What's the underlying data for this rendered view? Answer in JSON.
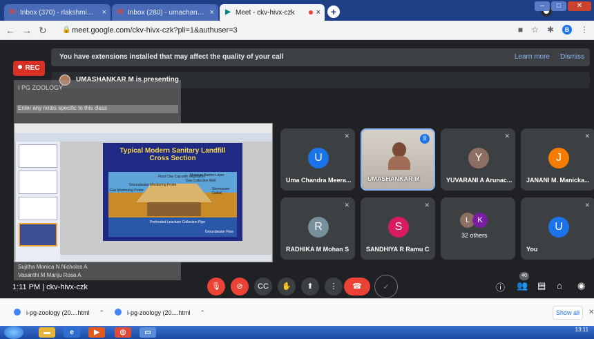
{
  "browser": {
    "tabs": [
      {
        "title": "Inbox (370) - rlakshmi@euxilium...",
        "icon": "gmail-icon",
        "fav": "M",
        "active": false
      },
      {
        "title": "Inbox (280) - umachandran@au...",
        "icon": "gmail-icon",
        "fav": "M",
        "active": false
      },
      {
        "title": "Meet - ckv-hivx-czk",
        "icon": "meet-icon",
        "fav": "▶",
        "active": true
      }
    ],
    "new_tab": "+",
    "url": "meet.google.com/ckv-hivx-czk?pli=1&authuser=3"
  },
  "meet": {
    "extension_banner": "You have extensions installed that may affect the quality of your call",
    "learn_more": "Learn more",
    "dismiss": "Dismiss",
    "rec_label": "REC",
    "presenting": "UMASHANKAR M is presenting",
    "ghost_title": "I PG ZOOLOGY",
    "ghost_note": "Enter any notes specific to this class",
    "ghost_rows": [
      "Sujitha Monica N Nicholas A",
      "Vasanthi M Manju Rosa A"
    ],
    "slide_title_line1": "Typical Modern Sanitary Landfill",
    "slide_title_line2": "Cross Section",
    "slide_labels": {
      "gas_monitoring": "Gas Monitoring Probe",
      "groundwater": "Groundwater Monitoring Probe",
      "final_cap": "Final Clay Cap with Vegetation",
      "moisture": "Moisture Barrier Layer",
      "landfill_gas": "Landfill Gas to Fuel Source or Energy Utilization Plant",
      "gas_well": "Gas Collection Well",
      "stormwater": "Stormwater Outfall",
      "perforated": "Perforated Leachate Collection Pipe",
      "groundwater_flow": "Groundwater Flow"
    },
    "participants": [
      {
        "name": "Uma Chandra Meera...",
        "initial": "U",
        "color": "#1a73e8",
        "muted": true
      },
      {
        "name": "UMASHANKAR M",
        "initial": "",
        "color": "",
        "muted": false,
        "speaking": true
      },
      {
        "name": "YUVARANI A Arunac...",
        "initial": "Y",
        "color": "#8d6e63",
        "muted": true
      },
      {
        "name": "JANANI M. Manicka...",
        "initial": "J",
        "color": "#f57c00",
        "muted": true
      },
      {
        "name": "RADHIKA M Mohan S",
        "initial": "R",
        "color": "#78909c",
        "muted": true
      },
      {
        "name": "SANDHIYA R Ramu C",
        "initial": "S",
        "color": "#d81b60",
        "muted": true
      },
      {
        "name": "32 others",
        "initial": "",
        "color": "",
        "muted": false
      },
      {
        "name": "You",
        "initial": "U",
        "color": "#1a73e8",
        "muted": true
      }
    ],
    "others_initials": [
      "L",
      "K"
    ],
    "meeting_time": "1:11 PM",
    "meeting_code": "ckv-hivx-czk",
    "participant_count": "40"
  },
  "downloads": {
    "items": [
      "i-pg-zoology (20....html",
      "i-pg-zoology (20....html"
    ],
    "show_all": "Show all"
  },
  "taskbar": {
    "time": "13:11"
  },
  "colors": {
    "meet_bg": "#202124",
    "tile_bg": "#3c4043",
    "hang_up": "#ea4335",
    "accent": "#8ab4f8"
  }
}
